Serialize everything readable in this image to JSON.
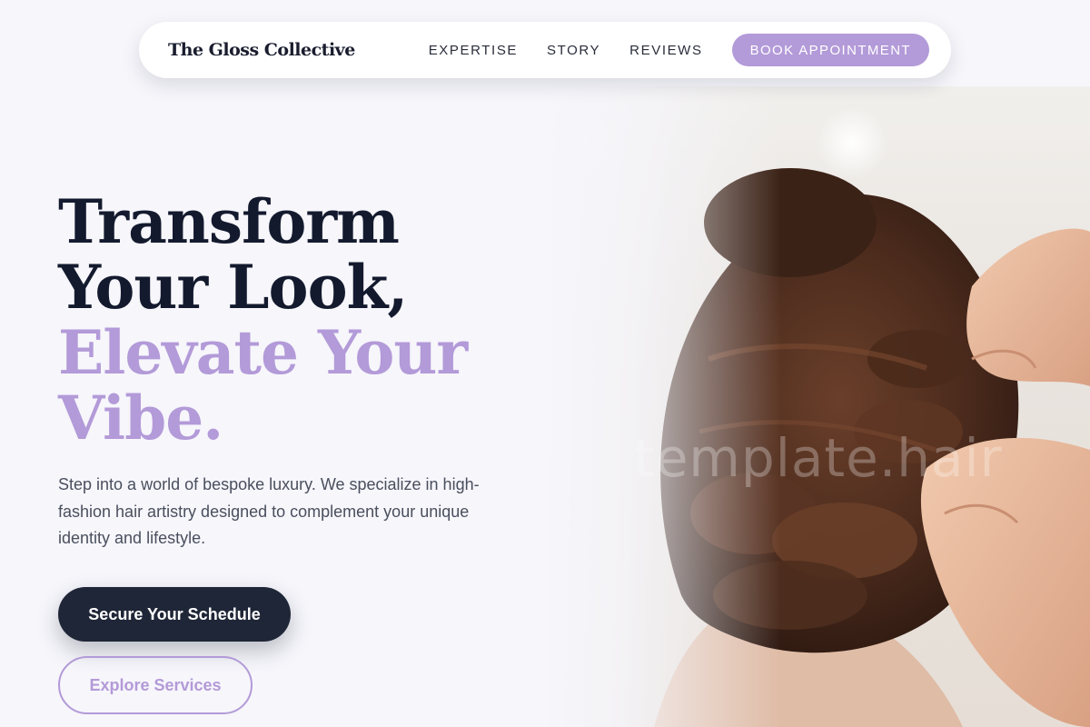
{
  "brand": {
    "name": "The Gloss Collective"
  },
  "nav": {
    "links": [
      "EXPERTISE",
      "STORY",
      "REVIEWS"
    ],
    "cta": "BOOK APPOINTMENT"
  },
  "hero": {
    "title_lines": [
      "Transform",
      "Your Look,"
    ],
    "accent_lines": [
      "Elevate Your",
      "Vibe."
    ],
    "description": "Step into a world of bespoke luxury. We specialize in high-fashion hair artistry designed to complement your unique identity and lifestyle.",
    "primary_cta": "Secure Your Schedule",
    "secondary_cta": "Explore Services",
    "image_watermark": "template.hair"
  },
  "colors": {
    "accent": "#b39ad8",
    "dark": "#1f2637",
    "heading": "#141a2e",
    "background": "#f6f6fb"
  }
}
